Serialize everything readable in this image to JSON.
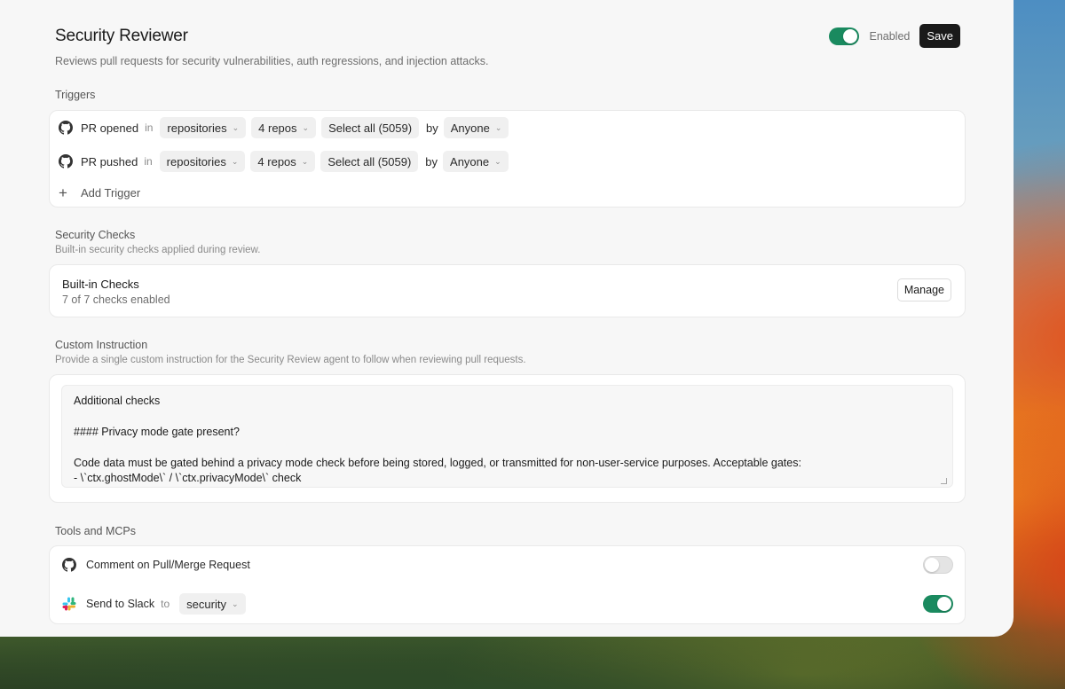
{
  "header": {
    "title": "Security Reviewer",
    "subtitle": "Reviews pull requests for security vulnerabilities, auth regressions, and injection attacks.",
    "enabled_label": "Enabled",
    "save_label": "Save",
    "enabled": true
  },
  "triggers": {
    "label": "Triggers",
    "rows": [
      {
        "event": "PR opened",
        "in": "in",
        "scope": "repositories",
        "repos": "4 repos",
        "select_all": "Select all (5059)",
        "by": "by",
        "actor": "Anyone",
        "icon": "github-icon"
      },
      {
        "event": "PR pushed",
        "in": "in",
        "scope": "repositories",
        "repos": "4 repos",
        "select_all": "Select all (5059)",
        "by": "by",
        "actor": "Anyone",
        "icon": "github-icon"
      }
    ],
    "add_label": "Add Trigger"
  },
  "security_checks": {
    "label": "Security Checks",
    "description": "Built-in security checks applied during review.",
    "card_title": "Built-in Checks",
    "count_text": "7 of 7 checks enabled",
    "manage_label": "Manage"
  },
  "custom_instruction": {
    "label": "Custom Instruction",
    "description": "Provide a single custom instruction for the Security Review agent to follow when reviewing pull requests.",
    "value": "Additional checks\n\n#### Privacy mode gate present?\n\nCode data must be gated behind a privacy mode check before being stored, logged, or transmitted for non-user-service purposes. Acceptable gates:\n- \\`ctx.ghostMode\\` / \\`ctx.privacyMode\\` check"
  },
  "tools": {
    "label": "Tools and MCPs",
    "items": [
      {
        "label": "Comment on Pull/Merge Request",
        "icon": "github-icon",
        "enabled": false
      },
      {
        "label": "Send to Slack",
        "icon": "slack-icon",
        "to": "to",
        "channel": "security",
        "enabled": true
      }
    ]
  },
  "colors": {
    "accent_green": "#1a8a5f",
    "panel_bg": "#f7f7f7"
  }
}
